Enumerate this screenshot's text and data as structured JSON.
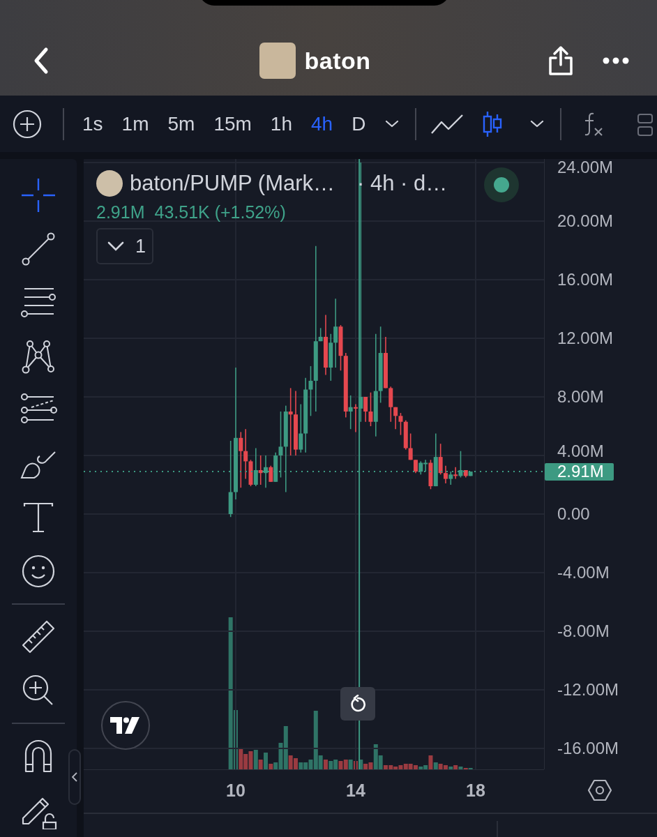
{
  "header": {
    "title": "baton"
  },
  "toolbar": {
    "intervals": [
      {
        "label": "1s",
        "selected": false
      },
      {
        "label": "1m",
        "selected": false
      },
      {
        "label": "5m",
        "selected": false
      },
      {
        "label": "15m",
        "selected": false
      },
      {
        "label": "1h",
        "selected": false
      },
      {
        "label": "4h",
        "selected": true
      },
      {
        "label": "D",
        "selected": false
      }
    ],
    "chart_types": [
      {
        "kind": "line",
        "selected": false
      },
      {
        "kind": "candles",
        "selected": true
      }
    ]
  },
  "sidebar": {
    "tools": [
      {
        "kind": "crosshair",
        "selected": true
      },
      {
        "kind": "trendline",
        "selected": false
      },
      {
        "kind": "parallel",
        "selected": false
      },
      {
        "kind": "pattern",
        "selected": false
      },
      {
        "kind": "fib",
        "selected": false
      },
      {
        "kind": "brush",
        "selected": false
      },
      {
        "kind": "text",
        "selected": false
      },
      {
        "kind": "emoji",
        "selected": false
      },
      {
        "kind": "divider"
      },
      {
        "kind": "ruler",
        "selected": false
      },
      {
        "kind": "zoom",
        "selected": false
      },
      {
        "kind": "divider"
      },
      {
        "kind": "magnet",
        "selected": false
      },
      {
        "kind": "lock",
        "selected": false
      }
    ]
  },
  "legend": {
    "symbol": "baton/PUMP (Mark…",
    "details": "· 4h · d…",
    "price": "2.91M",
    "change": "43.51K (+1.52%)",
    "indicators_count": "1"
  },
  "chart": {
    "chart_data": {
      "type": "candlestick",
      "xlim": [
        4.93,
        20.28
      ],
      "ylim": [
        -17.43,
        24.24
      ],
      "grid": true,
      "ref_lines": [
        {
          "axis": "x",
          "value": 14.12
        },
        {
          "axis": "y",
          "value": 2.91,
          "label": "2.91M"
        }
      ],
      "x": [
        9.83,
        10,
        10.17,
        10.33,
        10.5,
        10.67,
        10.83,
        11,
        11.17,
        11.33,
        11.5,
        11.67,
        11.83,
        12,
        12.17,
        12.33,
        12.5,
        12.67,
        12.83,
        13,
        13.17,
        13.33,
        13.5,
        13.67,
        13.83,
        14,
        14.17,
        14.33,
        14.5,
        14.67,
        14.83,
        15,
        15.17,
        15.33,
        15.5,
        15.67,
        15.83,
        16,
        16.17,
        16.33,
        16.5,
        16.67,
        16.83,
        17,
        17.17,
        17.33,
        17.5,
        17.67,
        17.83
      ],
      "ohlc": [
        [
          0,
          5,
          -0.2,
          1.5
        ],
        [
          1.5,
          10,
          1,
          5.2
        ],
        [
          5.2,
          5.6,
          1.8,
          4.3
        ],
        [
          4.3,
          5.8,
          2.4,
          3.6
        ],
        [
          3.6,
          3.7,
          1.9,
          2
        ],
        [
          2,
          4.5,
          1.9,
          3
        ],
        [
          3,
          4,
          2,
          2.8
        ],
        [
          2.8,
          4,
          1.8,
          3.2
        ],
        [
          3.2,
          3.3,
          2.2,
          2.2
        ],
        [
          2.2,
          4.2,
          2.2,
          4
        ],
        [
          4,
          7,
          2.5,
          4.6
        ],
        [
          4.6,
          7.4,
          1.5,
          7
        ],
        [
          7,
          8.6,
          4,
          6.8
        ],
        [
          6.8,
          8.4,
          4,
          4.4
        ],
        [
          4.4,
          7.5,
          4.2,
          5.5
        ],
        [
          5.5,
          9.3,
          4.2,
          8.5
        ],
        [
          8.5,
          10.1,
          6.7,
          9.1
        ],
        [
          9.1,
          18.3,
          7,
          11.8
        ],
        [
          11.8,
          12.7,
          11.8,
          12.1
        ],
        [
          12.1,
          13.6,
          9.5,
          10
        ],
        [
          10,
          12.3,
          9.1,
          11.7
        ],
        [
          11.7,
          14.7,
          10,
          12.8
        ],
        [
          12.8,
          12.9,
          9.8,
          10.8
        ],
        [
          10.8,
          11,
          6.6,
          7
        ],
        [
          7,
          8.1,
          5.8,
          7.3
        ],
        [
          7.3,
          7.5,
          5.6,
          7.2
        ],
        [
          7.2,
          24,
          6.3,
          8
        ],
        [
          8,
          8,
          6.3,
          7
        ],
        [
          7,
          8.3,
          6,
          6.3
        ],
        [
          6.3,
          12.3,
          5.3,
          8.4
        ],
        [
          8.4,
          12.8,
          7.6,
          11
        ],
        [
          11,
          12.1,
          8.6,
          8.6
        ],
        [
          8.6,
          8.7,
          6.3,
          7.3
        ],
        [
          7.3,
          7.3,
          5.8,
          6.7
        ],
        [
          6.7,
          6.9,
          5.4,
          6.3
        ],
        [
          6.3,
          6.4,
          4.4,
          4.5
        ],
        [
          4.5,
          5.5,
          3.7,
          3.7
        ],
        [
          3.7,
          3.7,
          2.8,
          2.9
        ],
        [
          2.9,
          3.6,
          2.7,
          3.5
        ],
        [
          3.5,
          3.7,
          2.9,
          3.5
        ],
        [
          3.5,
          3.7,
          1.7,
          1.9
        ],
        [
          1.9,
          5.5,
          1.9,
          3.9
        ],
        [
          3.9,
          4.8,
          2.7,
          2.8
        ],
        [
          2.8,
          3.3,
          2.1,
          2.4
        ],
        [
          2.4,
          2.9,
          2,
          2.7
        ],
        [
          2.7,
          3.2,
          2.4,
          2.6
        ],
        [
          2.6,
          4.3,
          2.5,
          3
        ],
        [
          3,
          3,
          2.5,
          2.6
        ],
        [
          2.6,
          2.9,
          2.6,
          2.9
        ]
      ],
      "xticks": [
        {
          "value": 10,
          "label": "10"
        },
        {
          "value": 14,
          "label": "14"
        },
        {
          "value": 18,
          "label": "18"
        }
      ],
      "yticks": [
        {
          "value": 24,
          "label": "24.00M"
        },
        {
          "value": 20,
          "label": "20.00M"
        },
        {
          "value": 16,
          "label": "16.00M"
        },
        {
          "value": 12,
          "label": "12.00M"
        },
        {
          "value": 8,
          "label": "8.00M"
        },
        {
          "value": 4,
          "label": "4.00M"
        },
        {
          "value": 0,
          "label": "0.00"
        },
        {
          "value": -4,
          "label": "-4.00M"
        },
        {
          "value": -8,
          "label": "-8.00M"
        },
        {
          "value": -12,
          "label": "-12.00M"
        },
        {
          "value": -16,
          "label": "-16.00M"
        }
      ]
    }
  }
}
